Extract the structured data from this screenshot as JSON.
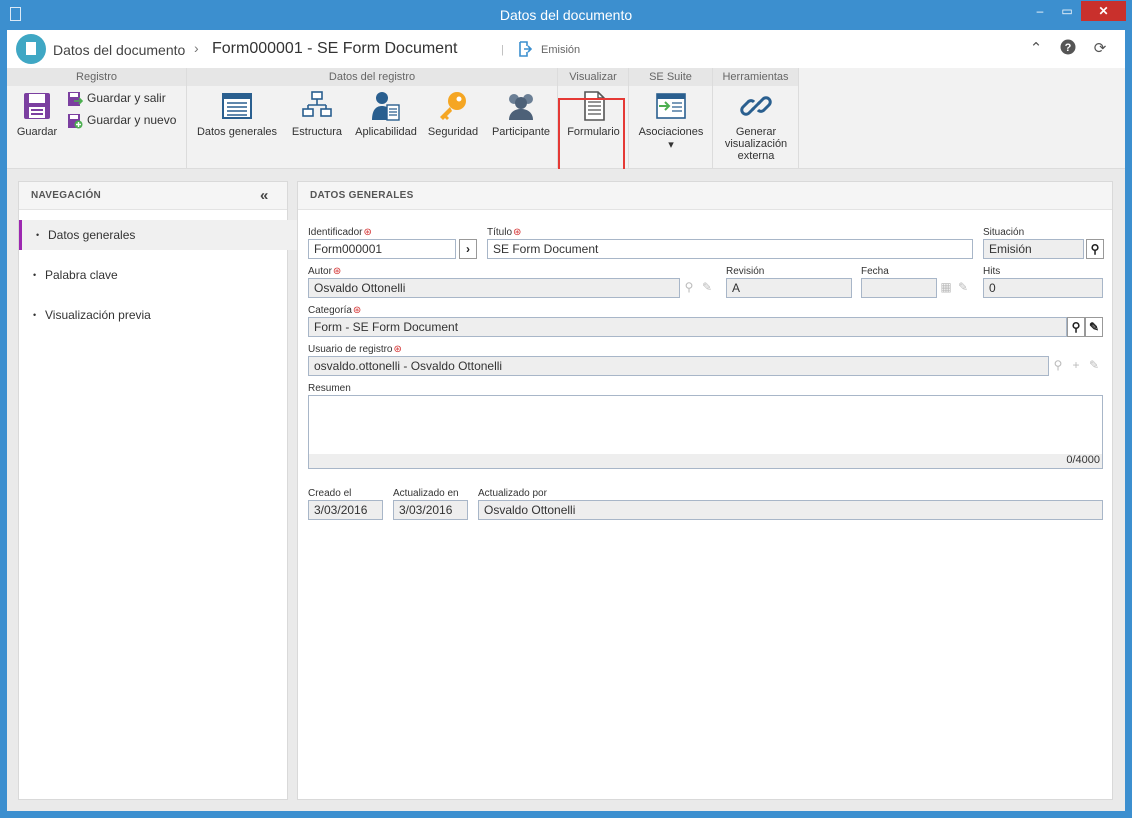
{
  "window": {
    "title": "Datos del documento",
    "min": "‒",
    "max": "▭",
    "close": "✕"
  },
  "header": {
    "crumb1": "Datos del documento",
    "crumb_sep": "›",
    "crumb2": "Form000001 - SE Form Document",
    "separator": "|",
    "stage": "Emisión",
    "icons": [
      "collapse-icon",
      "help-icon",
      "refresh-icon"
    ]
  },
  "ribbon": {
    "groups": {
      "registro": "Registro",
      "datos_registro": "Datos del registro",
      "visualizar": "Visualizar",
      "se_suite": "SE Suite",
      "herramientas": "Herramientas"
    },
    "guardar": "Guardar",
    "guardar_salir": "Guardar y salir",
    "guardar_nuevo": "Guardar y nuevo",
    "datos_generales": "Datos generales",
    "estructura": "Estructura",
    "aplicabilidad": "Aplicabilidad",
    "seguridad": "Seguridad",
    "participante": "Participante",
    "formulario": "Formulario",
    "asociaciones": "Asociaciones",
    "asociaciones_arrow": "▾",
    "generar1": "Generar",
    "generar2": "visualización",
    "generar3": "externa"
  },
  "nav": {
    "title": "NAVEGACIÓN",
    "collapse": "«",
    "items": [
      "Datos generales",
      "Palabra clave",
      "Visualización previa"
    ]
  },
  "form": {
    "title": "DATOS GENERALES",
    "identificador_label": "Identificador",
    "identificador": "Form000001",
    "titulo_label": "Título",
    "titulo": "SE Form Document",
    "situacion_label": "Situación",
    "situacion": "Emisión",
    "autor_label": "Autor",
    "autor": "Osvaldo Ottonelli",
    "revision_label": "Revisión",
    "revision": "A",
    "fecha_label": "Fecha",
    "fecha": "",
    "hits_label": "Hits",
    "hits": "0",
    "categoria_label": "Categoría",
    "categoria": "Form - SE Form Document",
    "usuario_label": "Usuario de registro",
    "usuario": "osvaldo.ottonelli - Osvaldo Ottonelli",
    "resumen_label": "Resumen",
    "resumen": "",
    "counter": "0/4000",
    "creado_label": "Creado el",
    "creado": "3/03/2016",
    "actualizado_label": "Actualizado en",
    "actualizado": "3/03/2016",
    "actualizado_por_label": "Actualizado por",
    "actualizado_por": "Osvaldo Ottonelli"
  },
  "colors": {
    "titlebar": "#3c8fcf",
    "accent": "#9c27b0",
    "highlight": "#e53935",
    "required": "#d32f2f"
  }
}
